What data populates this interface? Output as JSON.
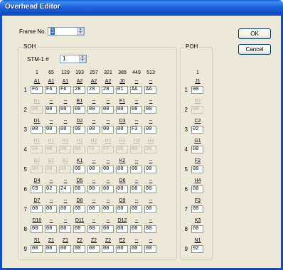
{
  "window": {
    "title": "Overhead Editor"
  },
  "frame_no": {
    "label": "Frame No.",
    "value": "1"
  },
  "buttons": {
    "ok": "OK",
    "cancel": "Cancel"
  },
  "soh": {
    "title": "SOH",
    "stm_label": "STM-1 #",
    "stm_value": "1",
    "columns": [
      "1",
      "65",
      "129",
      "193",
      "257",
      "321",
      "385",
      "449",
      "513"
    ],
    "rows": [
      {
        "num": "1",
        "labels": [
          "A1",
          "A1",
          "A1",
          "A2",
          "A2",
          "A2",
          "J0",
          "--",
          "--"
        ],
        "values": [
          "F6",
          "F6",
          "F6",
          "28",
          "28",
          "28",
          "01",
          "AA",
          "AA"
        ],
        "disabled": false
      },
      {
        "num": "2",
        "labels": [
          "B1",
          "--",
          "--",
          "E1",
          "--",
          "--",
          "F1",
          "--",
          "--"
        ],
        "values": [
          "00",
          "00",
          "00",
          "00",
          "00",
          "00",
          "00",
          "00",
          "00"
        ],
        "disabled": false,
        "first_disabled": true
      },
      {
        "num": "3",
        "labels": [
          "D1",
          "--",
          "--",
          "D2",
          "--",
          "--",
          "D3",
          "--",
          "--"
        ],
        "values": [
          "00",
          "00",
          "00",
          "00",
          "00",
          "00",
          "00",
          "F3",
          "00"
        ],
        "disabled": false
      },
      {
        "num": "4",
        "labels": [
          "H1",
          "H1",
          "H1",
          "H2",
          "H2",
          "H2",
          "H3",
          "H3",
          "H3"
        ],
        "values": [
          "6A",
          "0B",
          "0B",
          "0A",
          "FF",
          "FF",
          "00",
          "00",
          "00"
        ],
        "disabled": true
      },
      {
        "num": "5",
        "labels": [
          "B2",
          "B2",
          "B2",
          "K1",
          "--",
          "--",
          "K2",
          "--",
          "--"
        ],
        "values": [
          "00",
          "00",
          "00",
          "00",
          "00",
          "00",
          "00",
          "00",
          "00"
        ],
        "disabled": false,
        "first3_disabled": true
      },
      {
        "num": "6",
        "labels": [
          "D4",
          "--",
          "--",
          "D5",
          "--",
          "--",
          "D6",
          "--",
          "--"
        ],
        "values": [
          "C9",
          "02",
          "24",
          "00",
          "00",
          "00",
          "00",
          "00",
          "00"
        ],
        "disabled": false
      },
      {
        "num": "7",
        "labels": [
          "D7",
          "--",
          "--",
          "D8",
          "--",
          "--",
          "D9",
          "--",
          "--"
        ],
        "values": [
          "00",
          "00",
          "00",
          "00",
          "00",
          "00",
          "00",
          "00",
          "00"
        ],
        "disabled": false
      },
      {
        "num": "8",
        "labels": [
          "D10",
          "--",
          "--",
          "D11",
          "--",
          "--",
          "D12",
          "--",
          "--"
        ],
        "values": [
          "00",
          "00",
          "00",
          "00",
          "00",
          "00",
          "00",
          "00",
          "00"
        ],
        "disabled": false
      },
      {
        "num": "9",
        "labels": [
          "S1",
          "Z1",
          "Z1",
          "Z2",
          "Z2",
          "Z2",
          "E2",
          "--",
          "--"
        ],
        "values": [
          "00",
          "00",
          "00",
          "00",
          "00",
          "00",
          "00",
          "00",
          "00"
        ],
        "disabled": false
      }
    ]
  },
  "poh": {
    "title": "POH",
    "column": "1",
    "rows": [
      {
        "num": "1",
        "label": "J1",
        "value": "00"
      },
      {
        "num": "2",
        "label": "B3",
        "value": "00",
        "disabled": true
      },
      {
        "num": "3",
        "label": "C2",
        "value": "02"
      },
      {
        "num": "4",
        "label": "G1",
        "value": "00"
      },
      {
        "num": "5",
        "label": "F2",
        "value": "00"
      },
      {
        "num": "6",
        "label": "H4",
        "value": "00"
      },
      {
        "num": "7",
        "label": "F3",
        "value": "00"
      },
      {
        "num": "8",
        "label": "K3",
        "value": "00"
      },
      {
        "num": "9",
        "label": "N1",
        "value": "92"
      }
    ]
  }
}
